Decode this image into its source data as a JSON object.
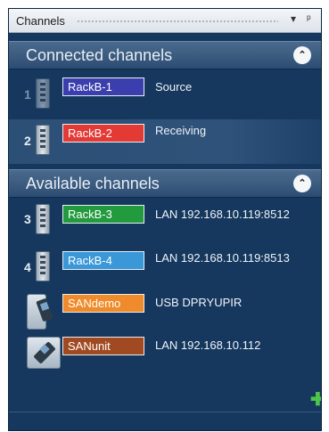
{
  "panel": {
    "title": "Channels",
    "dropdown_icon": "▾",
    "pin_icon": "ᵖ"
  },
  "connected": {
    "header": "Connected channels",
    "collapse_icon": "⌃",
    "items": [
      {
        "number": "1",
        "name": "RackB-1",
        "status": "Source",
        "color": "#3b3fae"
      },
      {
        "number": "2",
        "name": "RackB-2",
        "status": "Receiving",
        "color": "#e43a35"
      }
    ]
  },
  "available": {
    "header": "Available channels",
    "collapse_icon": "⌃",
    "items": [
      {
        "number": "3",
        "name": "RackB-3",
        "info": "LAN 192.168.10.119:8512",
        "color": "#229a3e"
      },
      {
        "number": "4",
        "name": "RackB-4",
        "info": "LAN 192.168.10.119:8513",
        "color": "#3a97d8"
      },
      {
        "number": "",
        "name": "SANdemo",
        "info": "USB DPRYUPIR",
        "color": "#ef8b2a"
      },
      {
        "number": "",
        "name": "SANunit",
        "info": "LAN 192.168.10.112",
        "color": "#a14a22"
      }
    ]
  },
  "add_icon": "✚"
}
